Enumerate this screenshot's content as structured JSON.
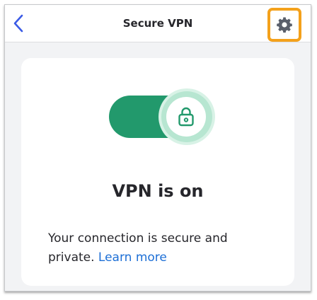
{
  "header": {
    "title": "Secure VPN",
    "back_icon": "chevron-left-icon",
    "settings_icon": "gear-icon"
  },
  "vpn": {
    "toggle_state": "on",
    "lock_icon": "lock-icon",
    "status_title": "VPN is on",
    "description": "Your connection is secure and private.",
    "learn_more_label": "Learn more"
  },
  "colors": {
    "accent_green": "#22996c",
    "link_blue": "#1d6fd6",
    "back_blue": "#3b5be6",
    "highlight_orange": "#f4a11b",
    "background": "#f2f3f5"
  }
}
